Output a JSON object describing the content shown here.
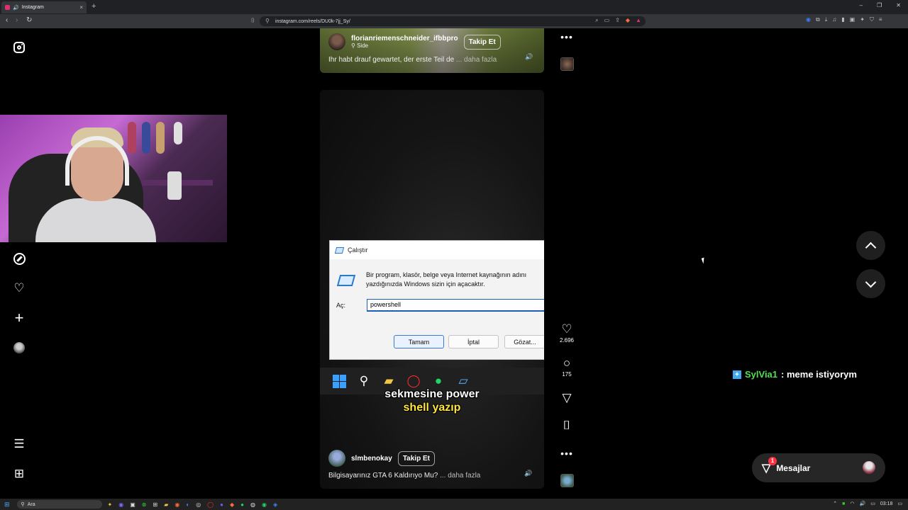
{
  "browser": {
    "tab_title": "Instagram",
    "tab_close": "×",
    "new_tab": "+",
    "url": "instagram.com/reels/DU0k-7jj_Sy/",
    "window_controls": [
      "–",
      "❐",
      "✕"
    ]
  },
  "sidebar": {
    "icons": [
      "instagram-logo",
      "explore-icon",
      "heart-icon",
      "create-icon",
      "profile-avatar",
      "menu-icon",
      "more-icon"
    ],
    "create": "+",
    "heart": "♡",
    "menu": "☰",
    "more": "⊞"
  },
  "reels": {
    "top": {
      "username": "florianriemenschneider_ifbbpro",
      "location": "Side",
      "follow": "Takip Et",
      "caption": "Ihr habt drauf gewartet, der erste Teil de",
      "more": "... daha fazla"
    },
    "main": {
      "username": "slmbenokay",
      "follow": "Takip Et",
      "caption": "Bilgisayarınız GTA 6 Kaldırıyo Mu?",
      "more": "... daha fazla",
      "subtitle_line1": "sekmesine power",
      "subtitle_line2": "shell yazıp"
    },
    "actions": {
      "likes": "2.696",
      "comments": "175",
      "like_icon": "♡",
      "comment_icon": "○",
      "share_icon": "▽",
      "save_icon": "⌷",
      "more": "•••"
    }
  },
  "run_dialog": {
    "title": "Çalıştır",
    "description": "Bir program, klasör, belge veya Internet kaynağının adını yazdığınızda Windows sizin için açacaktır.",
    "label": "Aç:",
    "input_value": "powershell",
    "ok": "Tamam",
    "cancel": "İptal",
    "browse": "Gözat..."
  },
  "chat": {
    "name": "SylVia1",
    "message": ": meme istiyorym"
  },
  "messages": {
    "label": "Mesajlar",
    "count": "1"
  },
  "os": {
    "search": "Ara",
    "time": "03:18"
  },
  "colors": {
    "background": "#000000",
    "accent_yellow": "#ffe63a",
    "chat_name": "#52e052",
    "notif_red": "#ff3040"
  }
}
